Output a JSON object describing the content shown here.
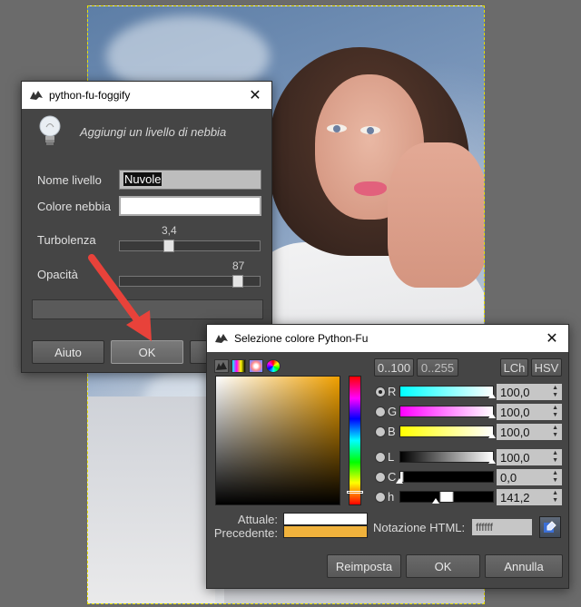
{
  "foggify": {
    "title": "python-fu-foggify",
    "description": "Aggiungi un livello di nebbia",
    "layer_name_label": "Nome livello",
    "layer_name_value": "Nuvole",
    "fog_color_label": "Colore nebbia",
    "turbulence_label": "Turbolenza",
    "turbulence_value": "3,4",
    "turbulence_fraction": 0.34,
    "opacity_label": "Opacità",
    "opacity_value": "87",
    "opacity_fraction": 0.87,
    "help_button": "Aiuto",
    "ok_button": "OK"
  },
  "color_dialog": {
    "title": "Selezione colore Python-Fu",
    "range_100": "0..100",
    "range_255": "0..255",
    "lch": "LCh",
    "hsv": "HSV",
    "channels": [
      {
        "label": "R",
        "value": "100,0"
      },
      {
        "label": "G",
        "value": "100,0"
      },
      {
        "label": "B",
        "value": "100,0"
      },
      {
        "label": "L",
        "value": "100,0"
      },
      {
        "label": "C",
        "value": "0,0"
      },
      {
        "label": "h",
        "value": "141,2"
      }
    ],
    "current_label": "Attuale:",
    "previous_label": "Precedente:",
    "current_color": "#ffffff",
    "previous_color": "#f0b23c",
    "html_label": "Notazione HTML:",
    "html_value": "ffffff",
    "reset_button": "Reimposta",
    "ok_button": "OK",
    "cancel_button": "Annulla"
  },
  "colors": {
    "dialog_bg": "#454545",
    "arrow": "#e8423a"
  }
}
